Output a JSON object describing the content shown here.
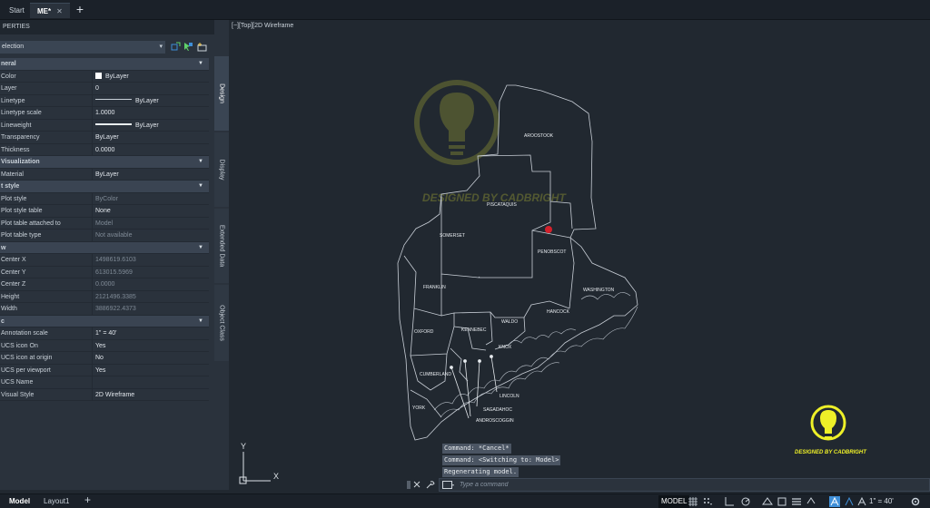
{
  "tabs": {
    "start": "Start",
    "drawing": "ME*",
    "close_glyph": "✕",
    "new_glyph": "+"
  },
  "palette": {
    "title": "PERTIES",
    "selection": "election",
    "side_tabs": [
      "Design",
      "Display",
      "Extended Data",
      "Object Class"
    ],
    "sections": {
      "general": "neral",
      "visualization": "Visualization",
      "plot_style": "t style",
      "view": "w",
      "misc": "c"
    },
    "general": {
      "color_label": "Color",
      "color_value": "ByLayer",
      "layer_label": "Layer",
      "layer_value": "0",
      "linetype_label": "Linetype",
      "linetype_value": "ByLayer",
      "ltscale_label": "Linetype scale",
      "ltscale_value": "1.0000",
      "lineweight_label": "Lineweight",
      "lineweight_value": "ByLayer",
      "transparency_label": "Transparency",
      "transparency_value": "ByLayer",
      "thickness_label": "Thickness",
      "thickness_value": "0.0000"
    },
    "visualization": {
      "material_label": "Material",
      "material_value": "ByLayer"
    },
    "plot_style": {
      "ps_label": "Plot style",
      "ps_value": "ByColor",
      "pst_label": "Plot style table",
      "pst_value": "None",
      "pta_label": "Plot table attached to",
      "pta_value": "Model",
      "ptt_label": "Plot table type",
      "ptt_value": "Not available"
    },
    "view": {
      "cx_label": "Center X",
      "cx_value": "1498619.6103",
      "cy_label": "Center Y",
      "cy_value": "613015.5969",
      "cz_label": "Center Z",
      "cz_value": "0.0000",
      "h_label": "Height",
      "h_value": "2121496.3385",
      "w_label": "Width",
      "w_value": "3886922.4373"
    },
    "misc": {
      "as_label": "Annotation scale",
      "as_value": "1\" = 40'",
      "ucson_label": "UCS icon On",
      "ucson_value": "Yes",
      "ucsorigin_label": "UCS icon at origin",
      "ucsorigin_value": "No",
      "ucsvp_label": "UCS per viewport",
      "ucsvp_value": "Yes",
      "ucsname_label": "UCS Name",
      "ucsname_value": "",
      "vs_label": "Visual Style",
      "vs_value": "2D Wireframe"
    }
  },
  "viewport": {
    "label": "[−][Top][2D Wireframe",
    "watermark": "DESIGNED BY CADBRIGHT",
    "logo_text": "DESIGNED BY CADBRIGHT",
    "axis_y": "Y",
    "axis_x": "X",
    "counties": [
      "AROOSTOOK",
      "PISCATAQUIS",
      "SOMERSET",
      "PENOBSCOT",
      "WASHINGTON",
      "FRANKLIN",
      "HANCOCK",
      "WALDO",
      "KENNEBEC",
      "OXFORD",
      "KNOX",
      "CUMBERLAND",
      "LINCOLN",
      "SAGADAHOC",
      "ANDROSCOGGIN",
      "YORK"
    ]
  },
  "command": {
    "history": [
      "Command: *Cancel*",
      "Command:  <Switching to: Model>",
      "Regenerating model."
    ],
    "placeholder": "Type a command"
  },
  "statusbar": {
    "model_tab": "Model",
    "layout_tab": "Layout1",
    "add_glyph": "+",
    "model_button": "MODEL",
    "scale": "1\" = 40'"
  },
  "colors": {
    "background": "#212830",
    "panel": "#2a323c",
    "accent_blue": "#3f8fd8",
    "logo_yellow": "#eef028",
    "marker_red": "#d3202b"
  }
}
